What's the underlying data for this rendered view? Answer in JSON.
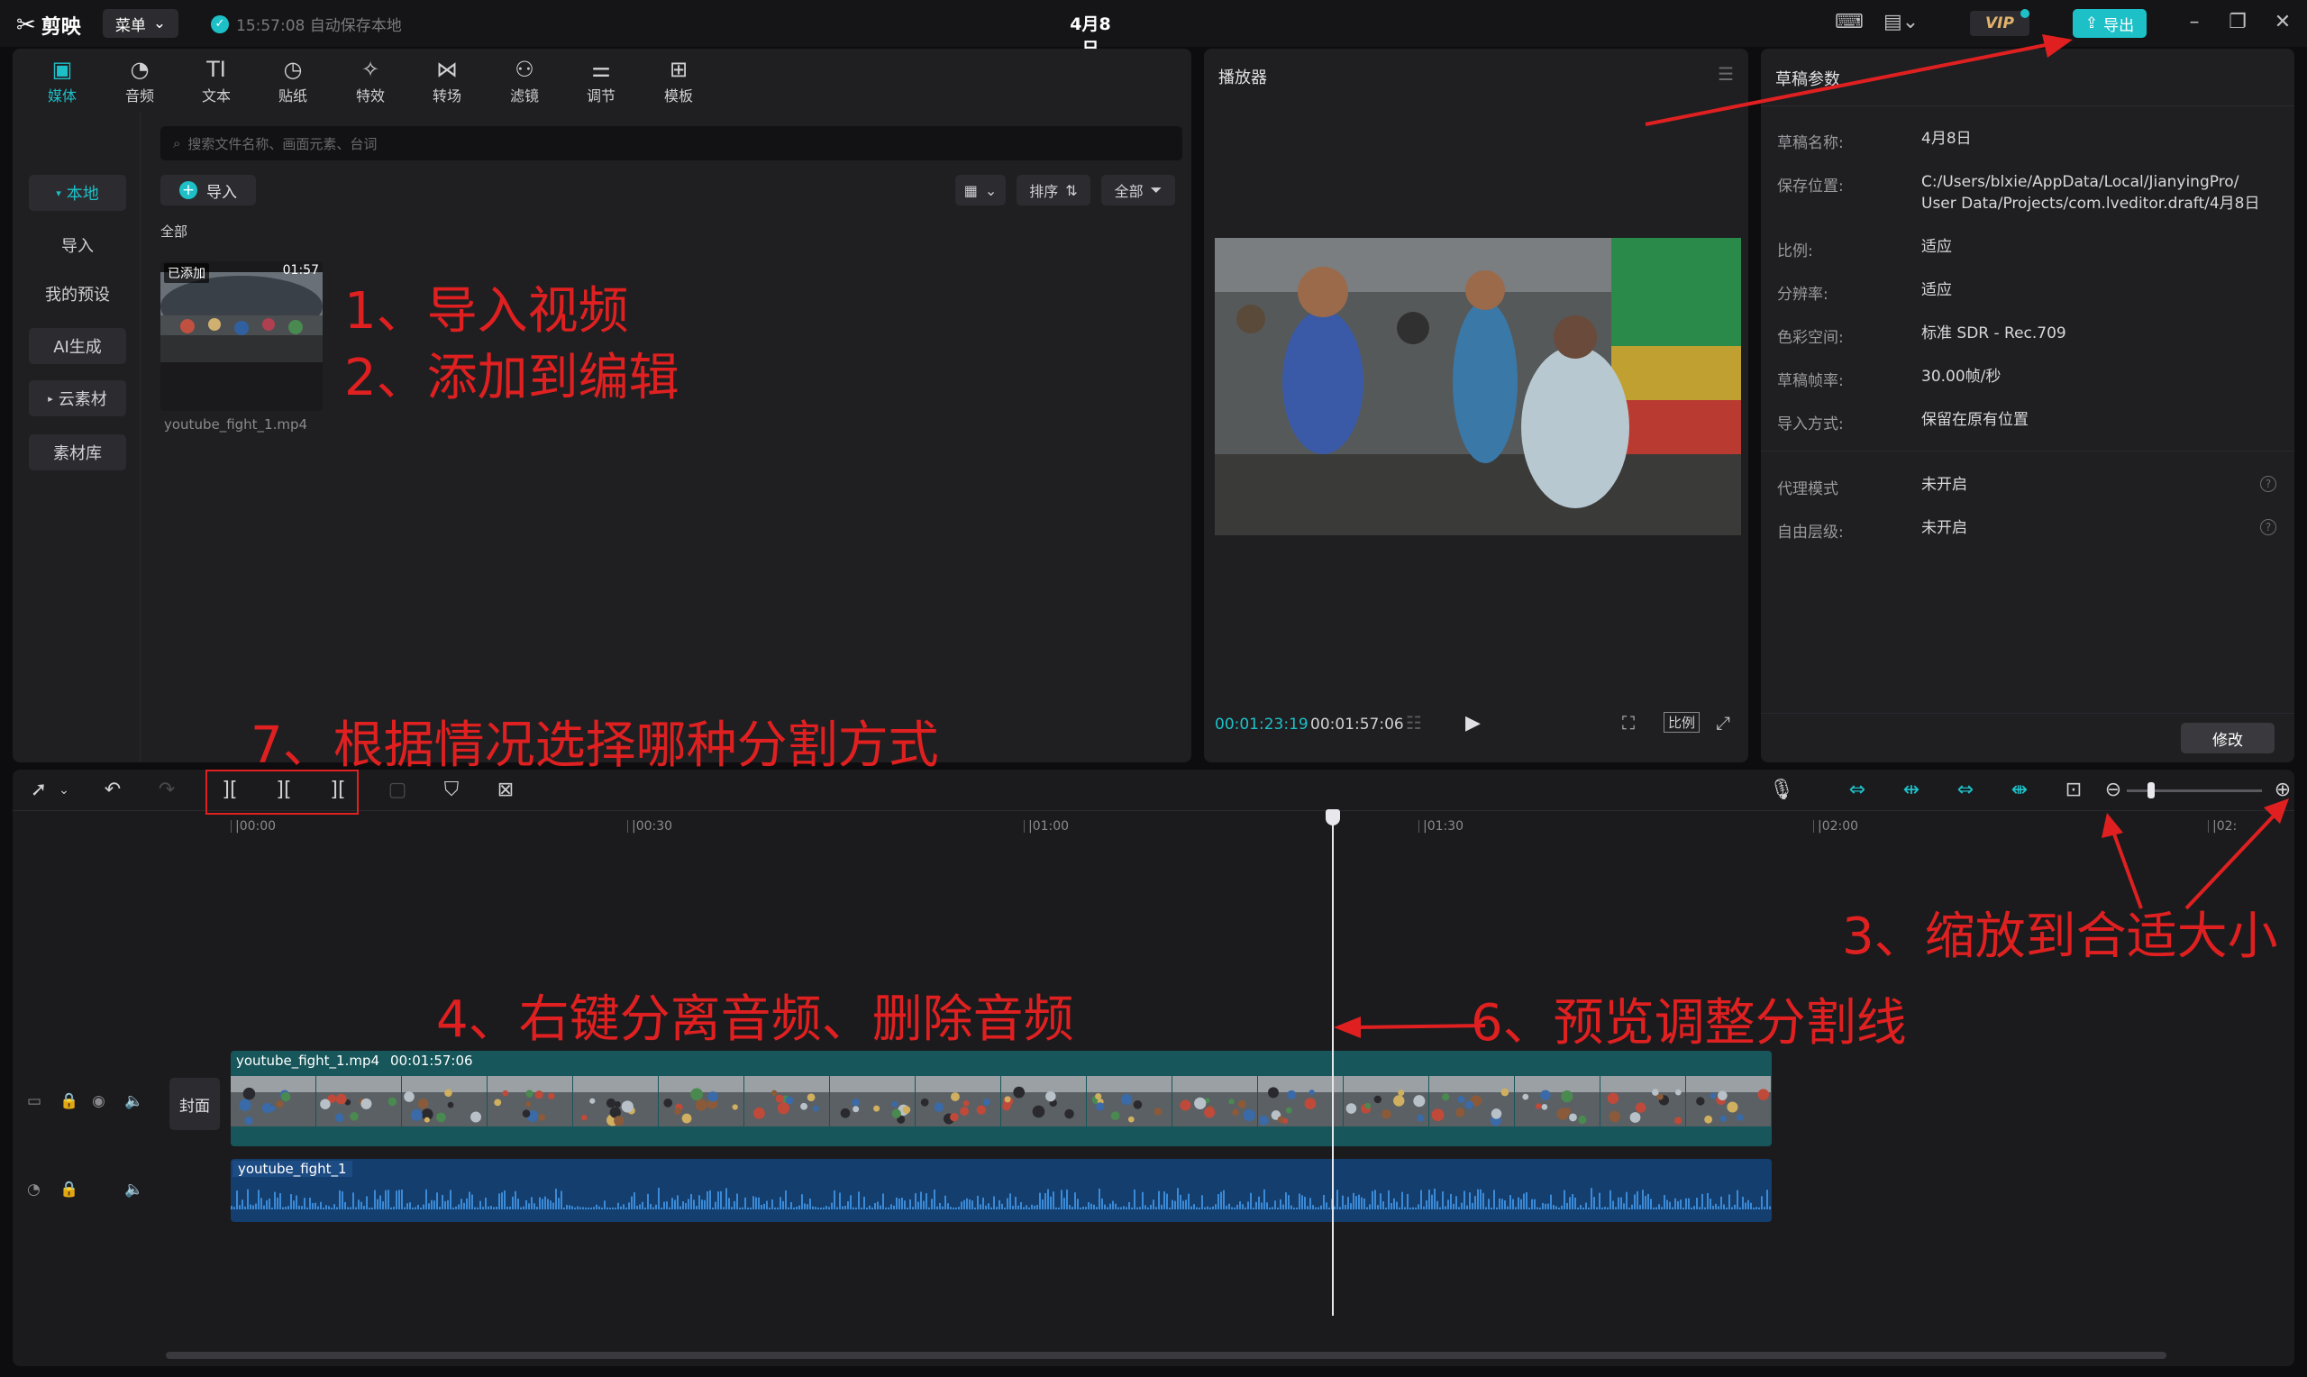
{
  "titlebar": {
    "app_name": "剪映",
    "menu_label": "菜单",
    "save_status": "15:57:08 自动保存本地",
    "doc_title": "4月8日",
    "vip_label": "VIP",
    "export_label": "导出"
  },
  "media_toolbar": {
    "tools": [
      {
        "label": "媒体",
        "icon": "media-icon"
      },
      {
        "label": "音频",
        "icon": "audio-icon"
      },
      {
        "label": "文本",
        "icon": "text-icon"
      },
      {
        "label": "贴纸",
        "icon": "sticker-icon"
      },
      {
        "label": "特效",
        "icon": "effects-icon"
      },
      {
        "label": "转场",
        "icon": "transition-icon"
      },
      {
        "label": "滤镜",
        "icon": "filter-icon"
      },
      {
        "label": "调节",
        "icon": "adjust-icon"
      },
      {
        "label": "模板",
        "icon": "template-icon"
      }
    ]
  },
  "sidebar": {
    "items": [
      "本地",
      "导入",
      "我的预设",
      "AI生成",
      "云素材",
      "素材库"
    ]
  },
  "media": {
    "search_placeholder": "搜索文件名称、画面元素、台词",
    "import_label": "导入",
    "sort_label": "排序",
    "filter_label": "全部",
    "category": "全部",
    "clip": {
      "added_tag": "已添加",
      "duration": "01:57",
      "name": "youtube_fight_1.mp4"
    }
  },
  "player": {
    "title": "播放器",
    "current_time": "00:01:23:19",
    "total_time": "00:01:57:06",
    "ratio_label": "比例"
  },
  "props": {
    "title": "草稿参数",
    "rows": [
      {
        "label": "草稿名称:",
        "value": "4月8日"
      },
      {
        "label": "保存位置:",
        "value": "C:/Users/blxie/AppData/Local/JianyingPro/",
        "value2": "User Data/Projects/com.lveditor.draft/4月8日"
      },
      {
        "label": "比例:",
        "value": "适应"
      },
      {
        "label": "分辨率:",
        "value": "适应"
      },
      {
        "label": "色彩空间:",
        "value": "标准 SDR - Rec.709"
      },
      {
        "label": "草稿帧率:",
        "value": "30.00帧/秒"
      },
      {
        "label": "导入方式:",
        "value": "保留在原有位置"
      },
      {
        "label": "代理模式",
        "value": "未开启"
      },
      {
        "label": "自由层级:",
        "value": "未开启"
      }
    ],
    "modify_label": "修改"
  },
  "timeline": {
    "ruler": [
      "|00:00",
      "|00:30",
      "|01:00",
      "|01:30",
      "|02:00",
      "|02:"
    ],
    "cover_label": "封面",
    "video_clip_name": "youtube_fight_1.mp4",
    "video_clip_duration": "00:01:57:06",
    "audio_clip_name": "youtube_fight_1",
    "zoom_level": 0.18
  },
  "annotations": {
    "a1": "1、导入视频",
    "a2": "2、添加到编辑",
    "a3": "3、缩放到合适大小",
    "a4": "4、右键分离音频、删除音频",
    "a6": "6、预览调整分割线",
    "a7": "7、根据情况选择哪种分割方式"
  },
  "colors": {
    "accent": "#1ec0c8",
    "annotation": "#e02020",
    "panel": "#1f1f22",
    "video_clip": "#17565a",
    "audio_clip": "#143e6e"
  }
}
